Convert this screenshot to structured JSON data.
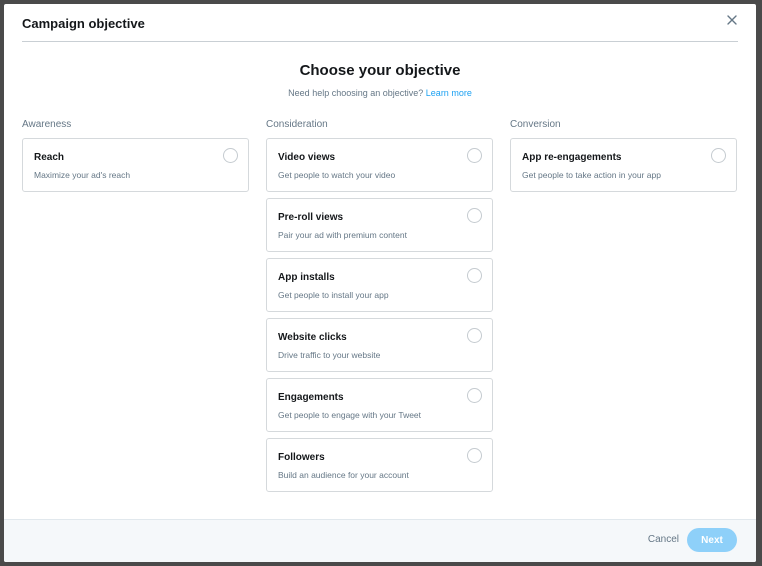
{
  "modal": {
    "title": "Campaign objective",
    "close_icon": "close-icon"
  },
  "main": {
    "heading": "Choose your objective",
    "help_text": "Need help choosing an objective?",
    "help_link": "Learn more"
  },
  "columns": [
    {
      "title": "Awareness",
      "options": [
        {
          "title": "Reach",
          "description": "Maximize your ad's reach",
          "selected": false
        }
      ]
    },
    {
      "title": "Consideration",
      "options": [
        {
          "title": "Video views",
          "description": "Get people to watch your video",
          "selected": false
        },
        {
          "title": "Pre-roll views",
          "description": "Pair your ad with premium content",
          "selected": false
        },
        {
          "title": "App installs",
          "description": "Get people to install your app",
          "selected": false
        },
        {
          "title": "Website clicks",
          "description": "Drive traffic to your website",
          "selected": false
        },
        {
          "title": "Engagements",
          "description": "Get people to engage with your Tweet",
          "selected": false
        },
        {
          "title": "Followers",
          "description": "Build an audience for your account",
          "selected": false
        }
      ]
    },
    {
      "title": "Conversion",
      "options": [
        {
          "title": "App re-engagements",
          "description": "Get people to take action in your app",
          "selected": false
        }
      ]
    }
  ],
  "footer": {
    "cancel_label": "Cancel",
    "next_label": "Next"
  },
  "colors": {
    "accent": "#1da1f2",
    "next_disabled": "#8ed0f9"
  }
}
